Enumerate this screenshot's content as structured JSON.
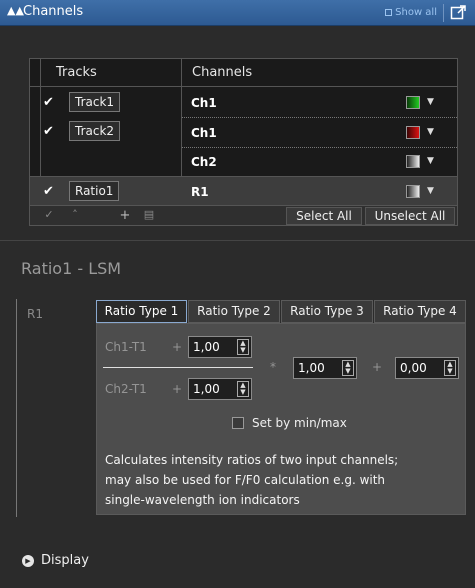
{
  "header": {
    "title": "Channels",
    "show_all": "Show all",
    "icons": [
      "channels-icon",
      "popout-icon"
    ]
  },
  "tracks_table": {
    "columns": [
      "Tracks",
      "Channels"
    ],
    "rows": [
      {
        "track": "Track1",
        "checked": true,
        "channel": "Ch1",
        "color": "#22cc22",
        "highlighted": false
      },
      {
        "track": "Track2",
        "checked": true,
        "channel": "Ch1",
        "color": "#dd1111",
        "highlighted": false
      },
      {
        "track": "",
        "checked": false,
        "channel": "Ch2",
        "color": "#dddddd",
        "highlighted": false
      },
      {
        "track": "Ratio1",
        "checked": true,
        "channel": "R1",
        "color": "#dddddd",
        "highlighted": true
      }
    ],
    "toolbar": {
      "icons": [
        "check-icon",
        "move-up-icon",
        "add-icon",
        "delete-icon"
      ],
      "select_all": "Select All",
      "unselect_all": "Unselect All"
    }
  },
  "section": {
    "title": "Ratio1 - LSM",
    "channel_label": "R1"
  },
  "ratio": {
    "tabs": [
      "Ratio Type 1",
      "Ratio Type 2",
      "Ratio Type 3",
      "Ratio Type 4"
    ],
    "active_tab": "Ratio Type 1",
    "numerator_label": "Ch1-T1",
    "numerator_value": "1,00",
    "denominator_label": "Ch2-T1",
    "denominator_value": "1,00",
    "plus": "+",
    "multiply": "*",
    "factor_value": "1,00",
    "offset_value": "0,00",
    "set_by_min_max": "Set by min/max",
    "set_by_min_max_checked": false,
    "description_lines": [
      "Calculates intensity ratios of two input channels;",
      "may also be used for F/F0 calculation e.g. with",
      "single-wavelength ion indicators"
    ]
  },
  "display": {
    "label": "Display"
  }
}
